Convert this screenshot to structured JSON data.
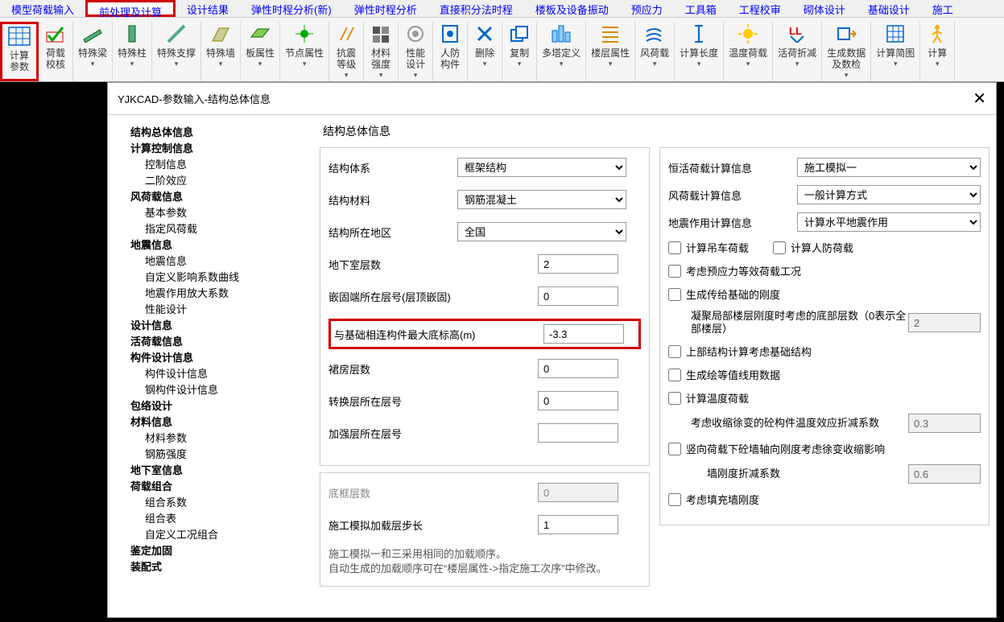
{
  "menubar": [
    "模型荷载输入",
    "前处理及计算",
    "设计结果",
    "弹性时程分析(新)",
    "弹性时程分析",
    "直接积分法时程",
    "楼板及设备振动",
    "预应力",
    "工具箱",
    "工程校审",
    "砌体设计",
    "基础设计",
    "施工"
  ],
  "menubar_highlight_index": 1,
  "toolbar": [
    {
      "label": "计算\n参数",
      "drop": false,
      "highlight": true,
      "icon": "grid"
    },
    {
      "label": "荷载\n校核",
      "drop": false,
      "icon": "check"
    },
    {
      "label": "特殊梁",
      "drop": true,
      "icon": "beam"
    },
    {
      "label": "特殊柱",
      "drop": true,
      "icon": "column"
    },
    {
      "label": "特殊支撑",
      "drop": true,
      "icon": "brace"
    },
    {
      "label": "特殊墙",
      "drop": true,
      "icon": "wall"
    },
    {
      "label": "板属性",
      "drop": true,
      "icon": "slab"
    },
    {
      "label": "节点属性",
      "drop": true,
      "icon": "node"
    },
    {
      "label": "抗震\n等级",
      "drop": true,
      "icon": "seismic"
    },
    {
      "label": "材料\n强度",
      "drop": true,
      "icon": "material"
    },
    {
      "label": "性能\n设计",
      "drop": true,
      "icon": "perf"
    },
    {
      "label": "人防\n构件",
      "drop": false,
      "icon": "defense"
    },
    {
      "label": "删除",
      "drop": true,
      "icon": "delete"
    },
    {
      "label": "复制",
      "drop": true,
      "icon": "copy"
    },
    {
      "label": "多塔定义",
      "drop": true,
      "icon": "tower"
    },
    {
      "label": "楼层属性",
      "drop": true,
      "icon": "floor"
    },
    {
      "label": "风荷载",
      "drop": true,
      "icon": "wind"
    },
    {
      "label": "计算长度",
      "drop": true,
      "icon": "length"
    },
    {
      "label": "温度荷载",
      "drop": true,
      "icon": "temp"
    },
    {
      "label": "活荷折减",
      "drop": true,
      "icon": "live"
    },
    {
      "label": "生成数据\n及数检",
      "drop": true,
      "icon": "gen"
    },
    {
      "label": "计算简图",
      "drop": true,
      "icon": "diagram"
    },
    {
      "label": "计算",
      "drop": true,
      "icon": "run"
    }
  ],
  "dialog": {
    "title": "YJKCAD-参数输入-结构总体信息",
    "tree": [
      {
        "t": "结构总体信息",
        "b": 1
      },
      {
        "t": "计算控制信息",
        "b": 1
      },
      {
        "t": "控制信息",
        "c": 1
      },
      {
        "t": "二阶效应",
        "c": 1
      },
      {
        "t": "风荷载信息",
        "b": 1
      },
      {
        "t": "基本参数",
        "c": 1
      },
      {
        "t": "指定风荷载",
        "c": 1
      },
      {
        "t": "地震信息",
        "b": 1
      },
      {
        "t": "地震信息",
        "c": 1
      },
      {
        "t": "自定义影响系数曲线",
        "c": 1
      },
      {
        "t": "地震作用放大系数",
        "c": 1
      },
      {
        "t": "性能设计",
        "c": 1
      },
      {
        "t": "设计信息",
        "b": 1
      },
      {
        "t": "活荷载信息",
        "b": 1
      },
      {
        "t": "构件设计信息",
        "b": 1
      },
      {
        "t": "构件设计信息",
        "c": 1
      },
      {
        "t": "钢构件设计信息",
        "c": 1
      },
      {
        "t": "包络设计",
        "b": 1
      },
      {
        "t": "材料信息",
        "b": 1
      },
      {
        "t": "材料参数",
        "c": 1
      },
      {
        "t": "钢筋强度",
        "c": 1
      },
      {
        "t": "地下室信息",
        "b": 1
      },
      {
        "t": "荷载组合",
        "b": 1
      },
      {
        "t": "组合系数",
        "c": 1
      },
      {
        "t": "组合表",
        "c": 1
      },
      {
        "t": "自定义工况组合",
        "c": 1
      },
      {
        "t": "鉴定加固",
        "b": 1
      },
      {
        "t": "装配式",
        "b": 1
      }
    ],
    "formtitle": "结构总体信息",
    "left": {
      "struct_system_label": "结构体系",
      "struct_system_value": "框架结构",
      "material_label": "结构材料",
      "material_value": "钢筋混凝土",
      "region_label": "结构所在地区",
      "region_value": "全国",
      "basement_label": "地下室层数",
      "basement_value": "2",
      "embed_label": "嵌固端所在层号(层顶嵌固)",
      "embed_value": "0",
      "foundation_label": "与基础相连构件最大底标高(m)",
      "foundation_value": "-3.3",
      "podium_label": "裙房层数",
      "podium_value": "0",
      "transfer_label": "转换层所在层号",
      "transfer_value": "0",
      "strength_label": "加强层所在层号",
      "strength_value": "",
      "bottomframe_label": "底框层数",
      "bottomframe_value": "0",
      "construct_step_label": "施工模拟加载层步长",
      "construct_step_value": "1",
      "note": "施工模拟一和三采用相同的加载顺序。\n自动生成的加载顺序可在“楼层属性->指定施工次序”中修改。"
    },
    "right": {
      "dl_label": "恒活荷载计算信息",
      "dl_value": "施工模拟一",
      "wind_label": "风荷载计算信息",
      "wind_value": "一般计算方式",
      "eq_label": "地震作用计算信息",
      "eq_value": "计算水平地震作用",
      "chk_crane": "计算吊车荷载",
      "chk_defense": "计算人防荷载",
      "chk_prestress": "考虑预应力等效荷载工况",
      "chk_foundation": "生成传给基础的刚度",
      "cohesion_label": "凝聚局部楼层刚度时考虑的底部层数（0表示全部楼层）",
      "cohesion_value": "2",
      "chk_upper": "上部结构计算考虑基础结构",
      "chk_contour": "生成绘等值线用数据",
      "chk_temp": "计算温度荷载",
      "shrink_label": "考虑收缩徐变的砼构件温度效应折减系数",
      "shrink_value": "0.3",
      "chk_vertical": "竖向荷载下砼墙轴向刚度考虑徐变收缩影响",
      "wall_label": "墙刚度折减系数",
      "wall_value": "0.6",
      "chk_infill": "考虑填充墙刚度"
    }
  }
}
